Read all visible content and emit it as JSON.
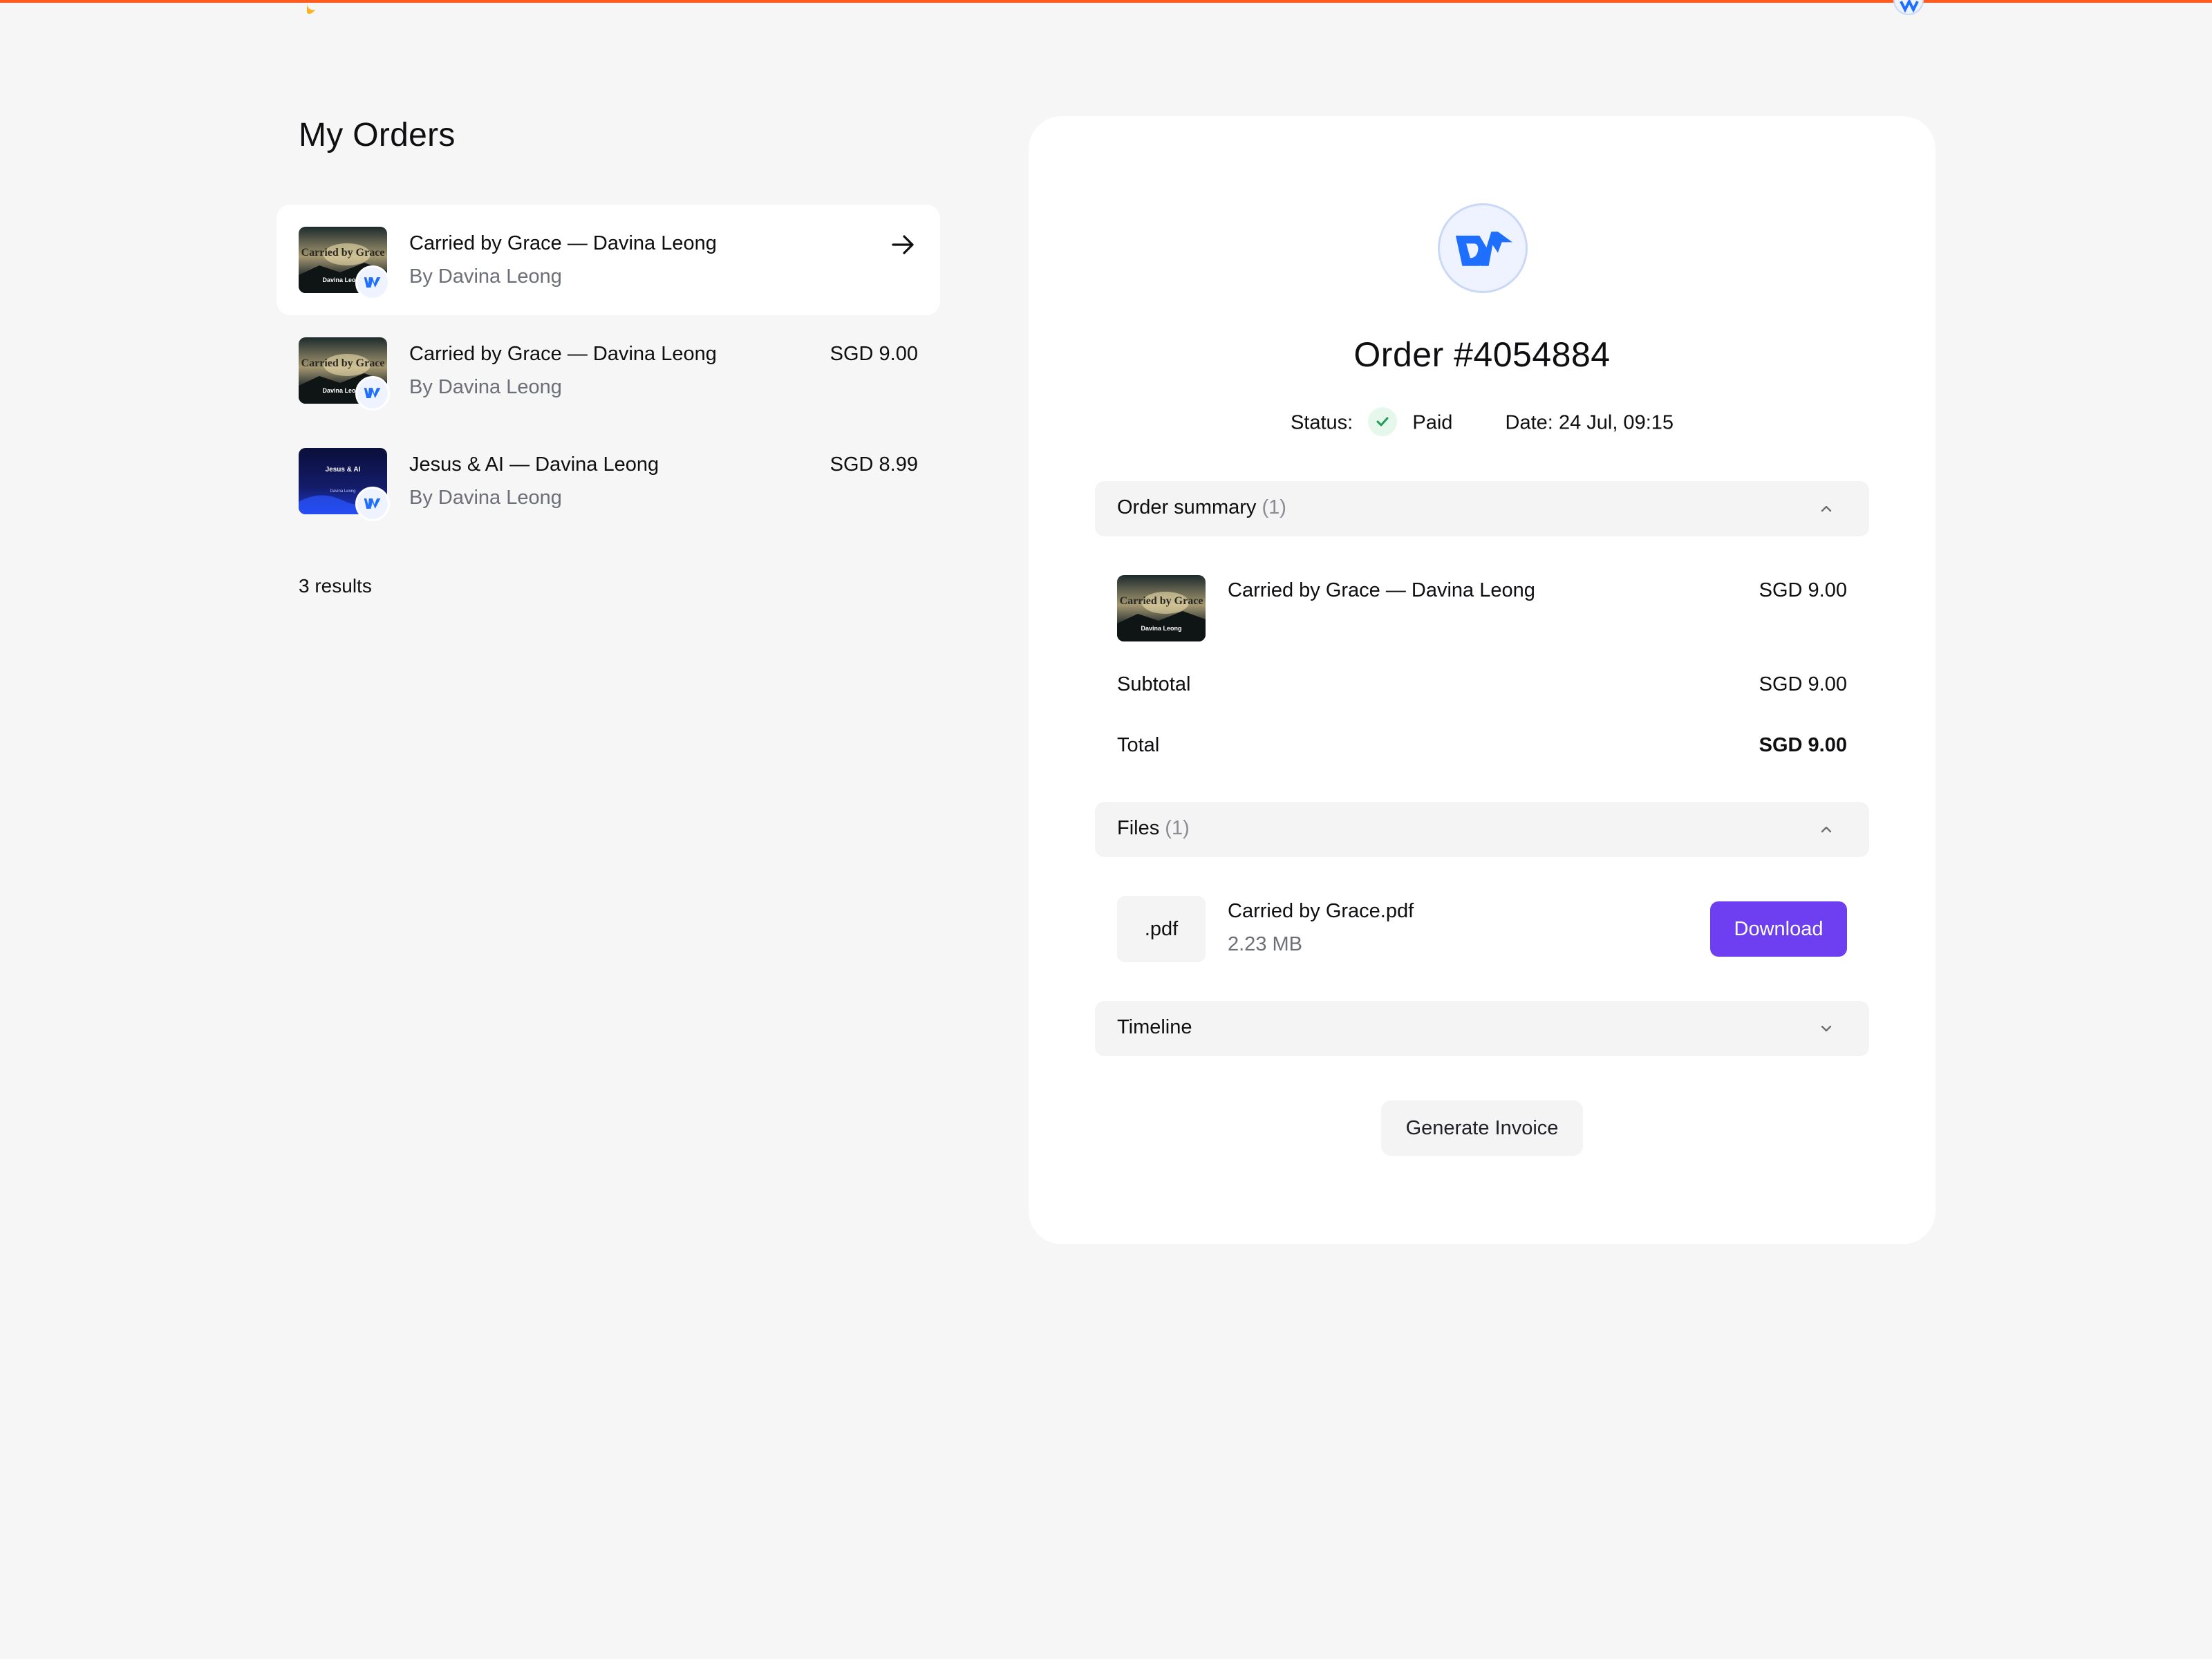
{
  "colors": {
    "accent": "#ff5b1f",
    "primary": "#6d3ff0",
    "brand_blue": "#1f6fff",
    "success": "#1f9d55"
  },
  "header": {
    "logo_icon": "flame-logo-icon",
    "avatar_icon": "user-avatar-icon"
  },
  "page": {
    "title": "My Orders"
  },
  "orders": [
    {
      "title": "Carried by Grace — Davina Leong",
      "subtitle": "By Davina Leong",
      "price": "",
      "thumb_icon": "carried-by-grace-cover",
      "thumb_text": "Carried by Grace",
      "thumb_author": "Davina Leong"
    },
    {
      "title": "Carried by Grace — Davina Leong",
      "subtitle": "By Davina Leong",
      "price": "SGD 9.00",
      "thumb_icon": "carried-by-grace-cover",
      "thumb_text": "Carried by Grace",
      "thumb_author": "Davina Leong"
    },
    {
      "title": "Jesus & AI — Davina Leong",
      "subtitle": "By Davina Leong",
      "price": "SGD 8.99",
      "thumb_icon": "jesus-and-ai-cover",
      "thumb_text": "Jesus & AI",
      "thumb_author": "Davina Leong"
    }
  ],
  "results_text": "3 results",
  "detail": {
    "order_number": "Order #4054884",
    "status_label": "Status:",
    "status_value": "Paid",
    "date_label": "Date:",
    "date_value": "24 Jul, 09:15",
    "summary": {
      "label": "Order summary",
      "count": "(1)",
      "item_title": "Carried by Grace — Davina Leong",
      "item_price": "SGD 9.00",
      "subtotal_label": "Subtotal",
      "subtotal_value": "SGD 9.00",
      "total_label": "Total",
      "total_value": "SGD 9.00"
    },
    "files": {
      "label": "Files",
      "count": "(1)",
      "file_ext": ".pdf",
      "file_name": "Carried by Grace.pdf",
      "file_size": "2.23 MB",
      "download_label": "Download"
    },
    "timeline": {
      "label": "Timeline"
    },
    "invoice_label": "Generate Invoice"
  }
}
